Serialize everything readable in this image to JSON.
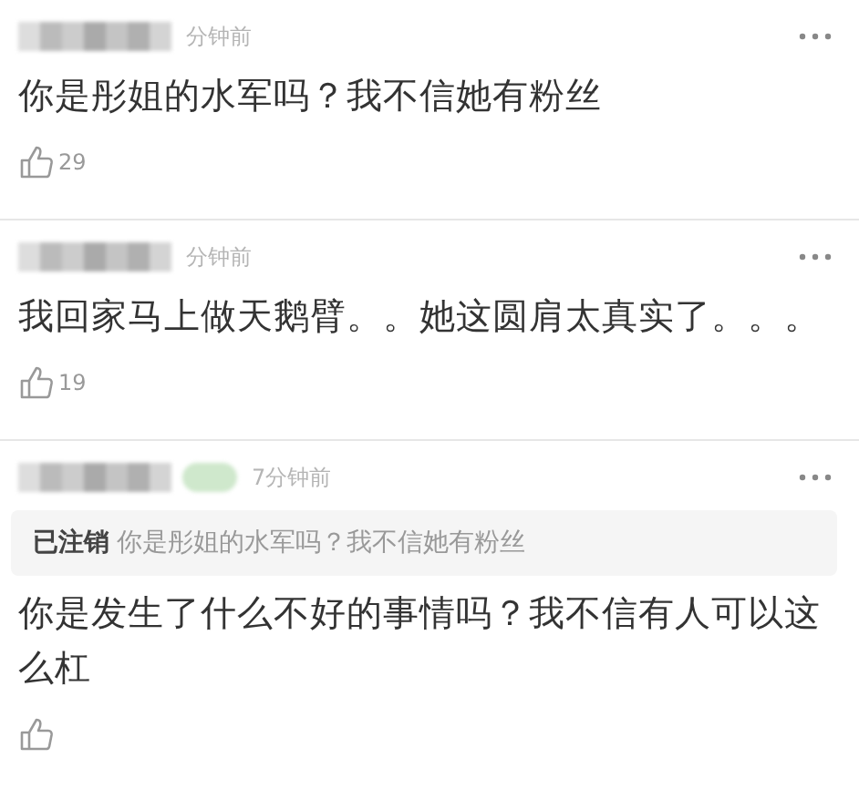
{
  "comments": [
    {
      "name_blurred": true,
      "badge_blurred": false,
      "time": "分钟前",
      "text": "你是彤姐的水军吗？我不信她有粉丝",
      "likes": "29"
    },
    {
      "name_blurred": true,
      "badge_blurred": false,
      "time": "分钟前",
      "text": "我回家马上做天鹅臂。。她这圆肩太真实了。。。",
      "likes": "19"
    },
    {
      "name_blurred": true,
      "badge_blurred": true,
      "time": "7分钟前",
      "reply_to": {
        "author": "已注销",
        "text": "你是彤姐的水军吗？我不信她有粉丝"
      },
      "text": "你是发生了什么不好的事情吗？我不信有人可以这么杠"
    }
  ]
}
